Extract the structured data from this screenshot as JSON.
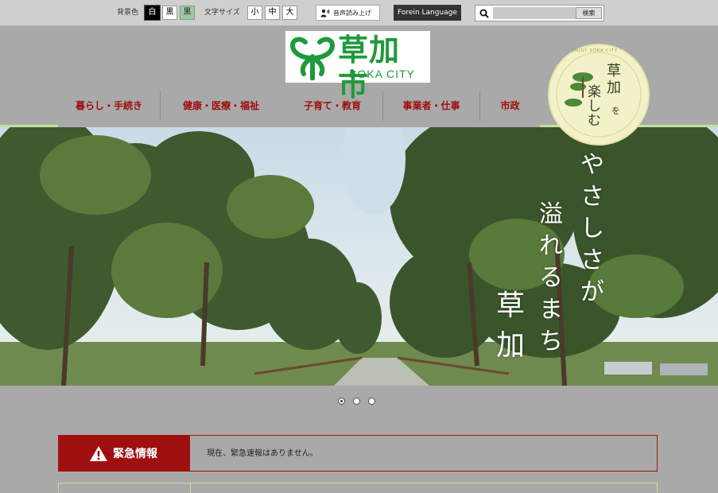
{
  "toolbar": {
    "bg_label": "背景色",
    "bg_options": [
      "白",
      "黒",
      "黒"
    ],
    "size_label": "文字サイズ",
    "size_options": [
      "小",
      "中",
      "大"
    ],
    "voice_label": "音声読み上げ",
    "lang_label": "Forein Language",
    "search_placeholder": "",
    "search_button": "検索"
  },
  "header": {
    "logo_text": "草加市",
    "logo_sub": "SOKA CITY",
    "badge_text": [
      "草加",
      "を",
      "楽しむ"
    ],
    "badge_ring": "ENJOY SOKA CITY"
  },
  "nav": {
    "items": [
      "暮らし・手続き",
      "健康・医療・福祉",
      "子育て・教育",
      "事業者・仕事",
      "市政"
    ]
  },
  "hero": {
    "tagline": [
      "やさしさが",
      "溢れるまち",
      "草加"
    ],
    "slide_count": 3,
    "active_slide": 1
  },
  "emergency": {
    "title": "緊急情報",
    "message": "現在、緊急速報はありません。"
  },
  "colors": {
    "accent_red": "#a00f0f",
    "brand_green": "#1e9a3c",
    "nav_line": "#bfe3a0"
  }
}
